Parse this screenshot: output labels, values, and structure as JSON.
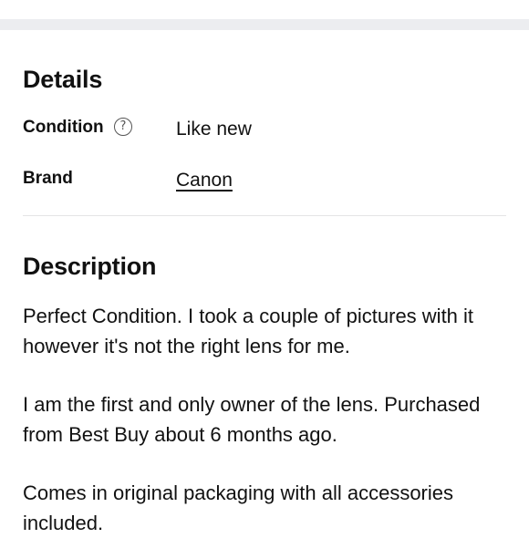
{
  "details": {
    "title": "Details",
    "condition": {
      "label": "Condition",
      "help_icon": "question-circle-icon",
      "help_glyph": "?",
      "value": "Like new"
    },
    "brand": {
      "label": "Brand",
      "value": "Canon"
    }
  },
  "description": {
    "title": "Description",
    "paragraphs": [
      "Perfect Condition. I took a couple of pictures with it however it's not the right lens for me.",
      "I am the first and only owner of the lens. Purchased from Best Buy about 6 months ago.",
      "Comes in original packaging with all accessories included."
    ]
  },
  "colors": {
    "top_band": "#ecedf0",
    "text": "#111111",
    "divider": "#e4e4e6"
  }
}
